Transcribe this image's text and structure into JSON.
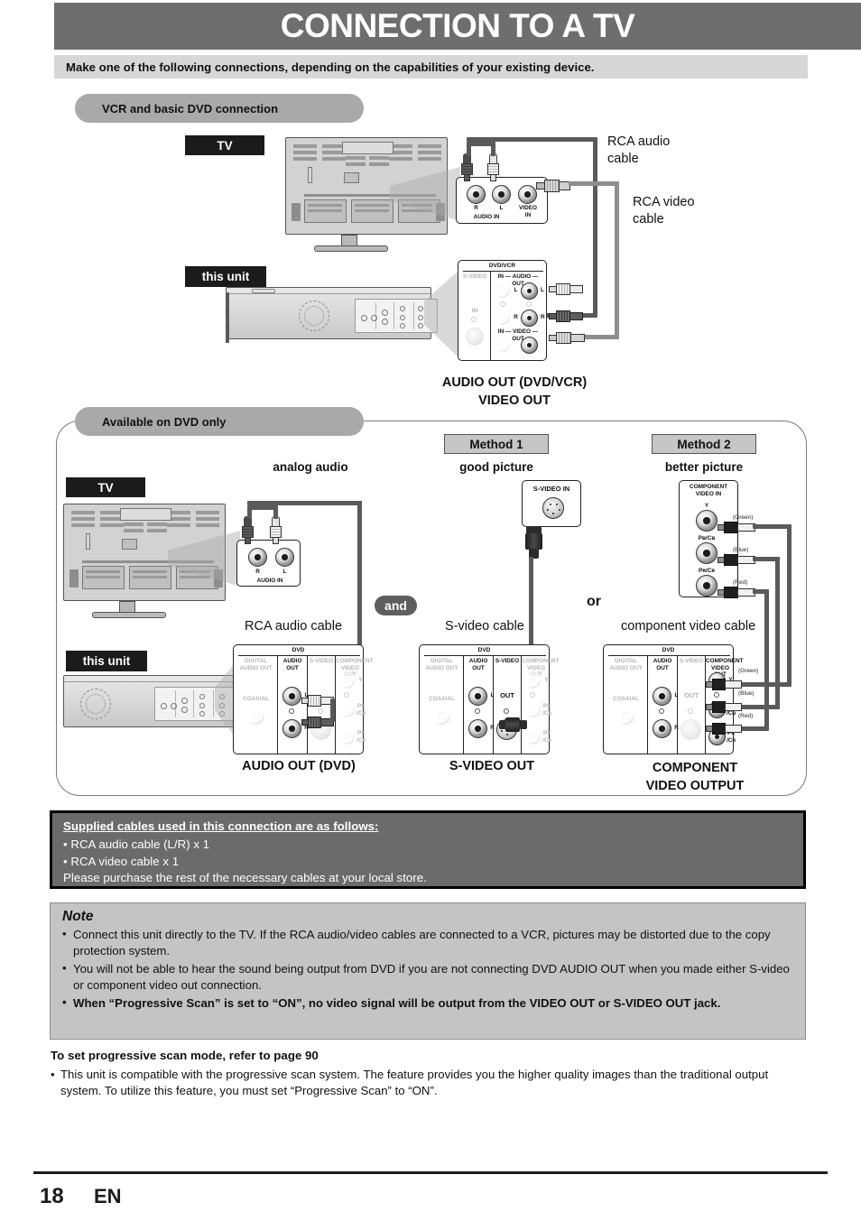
{
  "page": {
    "title": "CONNECTION TO A TV",
    "subtitle": "Make one of the following connections, depending on the capabilities of your existing device.",
    "page_number": "18",
    "language": "EN"
  },
  "section1": {
    "badge": "VCR and basic DVD connection",
    "tv_tag": "TV",
    "unit_tag": "this unit",
    "cable_rca_audio": "RCA audio\ncable",
    "cable_rca_video": "RCA video\ncable",
    "output_caption": "AUDIO OUT (DVD/VCR)\nVIDEO OUT",
    "tv_panel": {
      "jack_r": "R",
      "jack_l": "L",
      "jack_video": "VIDEO\nIN",
      "label_audio_in": "AUDIO IN"
    },
    "unit_panel": {
      "title": "DVD/VCR",
      "col_svideo": "S-VIDEO",
      "row_audio": "IN — AUDIO — OUT",
      "row_video": "IN — VIDEO — OUT",
      "label_in": "IN",
      "jack_l": "L",
      "jack_r": "R",
      "plug_l": "L",
      "plug_r": "R"
    }
  },
  "section2": {
    "badge": "Available on DVD only",
    "tv_tag": "TV",
    "unit_tag": "this unit",
    "and_label": "and",
    "or_label": "or",
    "columns": [
      {
        "method_badge": "",
        "heading": "analog audio",
        "cable_caption": "RCA audio cable",
        "output_caption": "AUDIO OUT (DVD)"
      },
      {
        "method_badge": "Method 1",
        "heading": "good picture",
        "cable_caption": "S-video cable",
        "output_caption": "S-VIDEO OUT"
      },
      {
        "method_badge": "Method 2",
        "heading": "better picture",
        "cable_caption": "component video cable",
        "output_caption": "COMPONENT\nVIDEO OUTPUT"
      }
    ],
    "tv_audio_panel": {
      "jack_r": "R",
      "jack_l": "L",
      "label": "AUDIO IN"
    },
    "tv_svideo_panel": {
      "title": "S-VIDEO IN"
    },
    "tv_component_panel": {
      "title": "COMPONENT\nVIDEO IN",
      "jacks": [
        {
          "label": "Y",
          "color": "(Green)"
        },
        {
          "label": "Pʙ/Cʙ",
          "color": "(Blue)"
        },
        {
          "label": "Pʀ/Cʀ",
          "color": "(Red)"
        }
      ]
    },
    "dvd_panel": {
      "title": "DVD",
      "col_digital": "DIGITAL\nAUDIO OUT",
      "col_coaxial": "COAXIAL",
      "col_audio": "AUDIO\nOUT",
      "col_svideo": "S-VIDEO",
      "col_component": "COMPONENT\nVIDEO OUT",
      "jack_l": "L",
      "jack_r": "R",
      "svideo_out": "OUT",
      "comp_y": "Y",
      "comp_pb": "Pʙ\n/Cʙ",
      "comp_pr": "Pʀ\n/Cʀ",
      "colors": {
        "green": "(Green)",
        "blue": "(Blue)",
        "red": "(Red)"
      }
    }
  },
  "supplied": {
    "heading": "Supplied cables used in this connection are as follows:",
    "items": [
      "• RCA audio cable (L/R) x 1",
      "• RCA video cable x 1"
    ],
    "footer": "Please purchase the rest of the necessary cables at your local store."
  },
  "note": {
    "heading": "Note",
    "items": [
      "Connect this unit directly to the TV. If the RCA audio/video cables are connected to a VCR, pictures may be distorted due to the copy protection system.",
      "You will not be able to hear the sound being output from DVD if you are not connecting DVD AUDIO OUT when you made either S-video or component video out connection.",
      "When “Progressive Scan” is set to “ON”, no video signal will be output from the VIDEO OUT or S-VIDEO OUT jack."
    ]
  },
  "progressive": {
    "heading": "To set progressive scan mode, refer to page 90",
    "body": "This unit is compatible with the progressive scan system. The feature provides you the higher quality images than the traditional output system. To utilize this feature, you must set “Progressive Scan” to “ON”."
  },
  "colors": {
    "header_bar": "#6e6e6e",
    "subtitle_bar": "#d7d7d7",
    "pill": "#a9a9a9",
    "black_tag": "#1b1b1b",
    "supplied_box": "#6b6b6b",
    "note_box": "#c4c4c4",
    "method_box": "#c6c6c6"
  }
}
